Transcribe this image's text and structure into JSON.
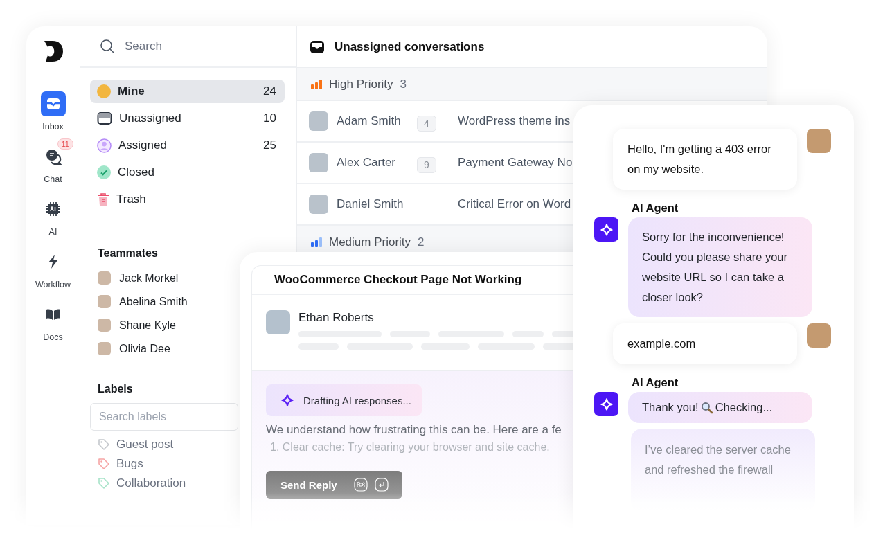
{
  "rail": {
    "items": [
      {
        "label": "Inbox",
        "selected": true
      },
      {
        "label": "Chat",
        "selected": false,
        "badge": "11"
      },
      {
        "label": "AI",
        "selected": false
      },
      {
        "label": "Workflow",
        "selected": false
      },
      {
        "label": "Docs",
        "selected": false
      }
    ]
  },
  "folders": {
    "search": {
      "placeholder": "Search"
    },
    "items": [
      {
        "kind": "avatar",
        "label": "Mine",
        "count": "24",
        "selected": true
      },
      {
        "kind": "inbox",
        "label": "Unassigned",
        "count": "10",
        "selected": false
      },
      {
        "kind": "person",
        "label": "Assigned",
        "count": "25",
        "selected": false
      },
      {
        "kind": "check",
        "label": "Closed",
        "selected": false
      },
      {
        "kind": "trash",
        "label": "Trash",
        "selected": false
      }
    ]
  },
  "teammates": {
    "title": "Teammates",
    "members": [
      {
        "name": "Jack Morkel"
      },
      {
        "name": "Abelina Smith"
      },
      {
        "name": "Shane Kyle"
      },
      {
        "name": "Olivia Dee"
      }
    ]
  },
  "labels": {
    "title": "Labels",
    "search": {
      "placeholder": "Search labels"
    },
    "items": [
      {
        "name": "Guest post",
        "color": "#c4c7cc"
      },
      {
        "name": "Bugs",
        "color": "#f6a5a5"
      },
      {
        "name": "Collaboration",
        "color": "#a7e3c9"
      }
    ]
  },
  "conversations": {
    "title": "Unassigned conversations",
    "groups": [
      {
        "kind": "high",
        "name": "High Priority",
        "count": "3",
        "rows": [
          {
            "name": "Adam Smith",
            "unread": "4",
            "subject": "WordPress theme ins"
          },
          {
            "name": "Alex Carter",
            "unread": "9",
            "subject": "Payment Gateway No"
          },
          {
            "name": "Daniel Smith",
            "subject": "Critical Error on Word"
          }
        ]
      },
      {
        "kind": "medium",
        "name": "Medium Priority",
        "count": "2"
      }
    ]
  },
  "ticket": {
    "title": "WooCommerce Checkout Page Not Working",
    "author": "Ethan Roberts",
    "status": "Drafting AI responses...",
    "draft": "We understand how frustrating this can be. Here are a fe",
    "step": "1. Clear cache: Try clearing your browser and site cache.",
    "button": "Send Reply"
  },
  "chat": {
    "messages": [
      {
        "kind": "user",
        "text": "Hello, I'm getting a 403 error on my website."
      },
      {
        "kind": "agent",
        "sender": "AI Agent",
        "text": "Sorry for the inconvenience! Could you please share your website URL so I can take a closer look?"
      },
      {
        "kind": "user",
        "text": "example.com"
      },
      {
        "kind": "agent-status",
        "sender": "AI Agent",
        "parts": [
          "Thank you!",
          "Checking..."
        ]
      },
      {
        "kind": "agent-more",
        "text": "I’ve cleared the server cache and refreshed the firewall"
      }
    ]
  }
}
